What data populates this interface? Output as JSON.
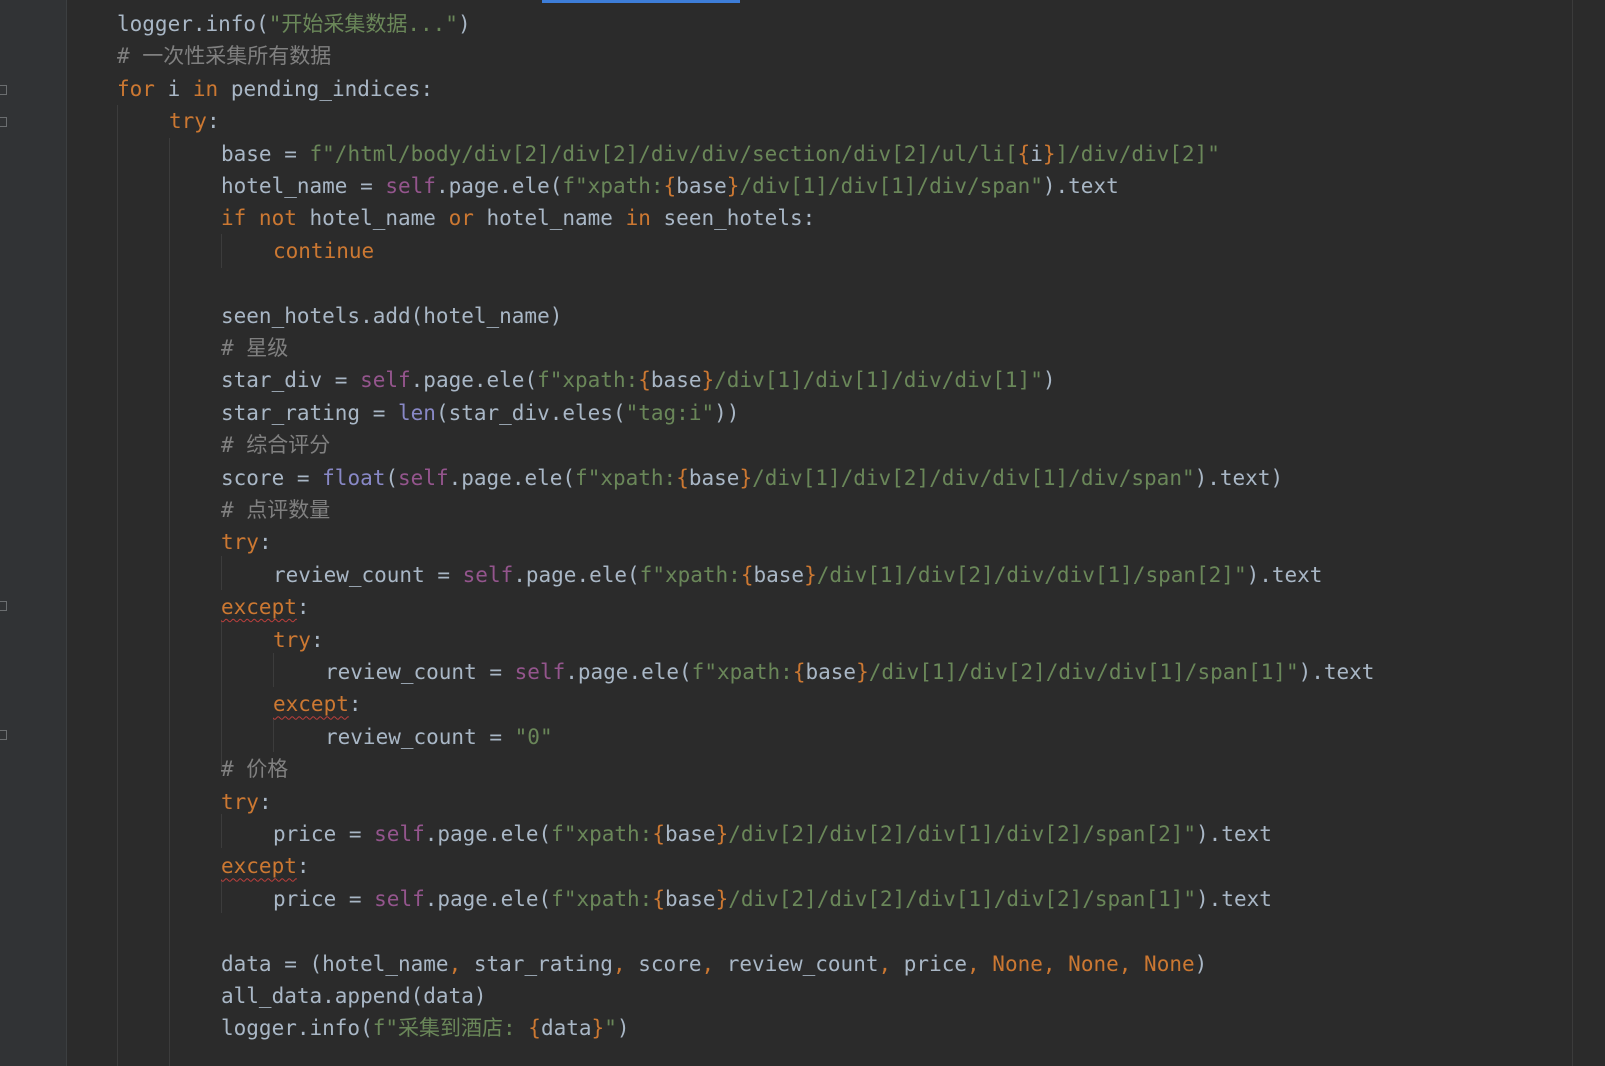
{
  "colors": {
    "background": "#2b2b2b",
    "gutter": "#313335",
    "keyword": "#cc7832",
    "self": "#94558d",
    "string": "#6a8759",
    "comment": "#808080",
    "builtin": "#8888c6",
    "text": "#a9b7c6",
    "scroll_thumb": "#3d7dd8",
    "warning_underline": "#bc3f3c"
  },
  "code_lines": [
    {
      "indent": 1,
      "tokens": [
        {
          "t": "logger.info(",
          "c": "plain"
        },
        {
          "t": "\"开始采集数据...\"",
          "c": "str"
        },
        {
          "t": ")",
          "c": "plain"
        }
      ]
    },
    {
      "indent": 1,
      "tokens": [
        {
          "t": "# 一次性采集所有数据",
          "c": "cmt"
        }
      ]
    },
    {
      "indent": 1,
      "tokens": [
        {
          "t": "for",
          "c": "kw"
        },
        {
          "t": " i ",
          "c": "plain"
        },
        {
          "t": "in",
          "c": "kw"
        },
        {
          "t": " pending_indices:",
          "c": "plain"
        }
      ]
    },
    {
      "indent": 2,
      "tokens": [
        {
          "t": "try",
          "c": "kw"
        },
        {
          "t": ":",
          "c": "plain"
        }
      ]
    },
    {
      "indent": 3,
      "tokens": [
        {
          "t": "base = ",
          "c": "plain"
        },
        {
          "t": "f\"/html/body/div[2]/div[2]/div/div/section/div[2]/ul/li[",
          "c": "str"
        },
        {
          "t": "{",
          "c": "br"
        },
        {
          "t": "i",
          "c": "plain"
        },
        {
          "t": "}",
          "c": "br"
        },
        {
          "t": "]/div/div[2]\"",
          "c": "str"
        }
      ]
    },
    {
      "indent": 3,
      "tokens": [
        {
          "t": "hotel_name = ",
          "c": "plain"
        },
        {
          "t": "self",
          "c": "self"
        },
        {
          "t": ".page.ele(",
          "c": "plain"
        },
        {
          "t": "f\"xpath:",
          "c": "str"
        },
        {
          "t": "{",
          "c": "br"
        },
        {
          "t": "base",
          "c": "plain"
        },
        {
          "t": "}",
          "c": "br"
        },
        {
          "t": "/div[1]/div[1]/div/span\"",
          "c": "str"
        },
        {
          "t": ").text",
          "c": "plain"
        }
      ]
    },
    {
      "indent": 3,
      "tokens": [
        {
          "t": "if not",
          "c": "kw"
        },
        {
          "t": " hotel_name ",
          "c": "plain"
        },
        {
          "t": "or",
          "c": "kw"
        },
        {
          "t": " hotel_name ",
          "c": "plain"
        },
        {
          "t": "in",
          "c": "kw"
        },
        {
          "t": " seen_hotels:",
          "c": "plain"
        }
      ]
    },
    {
      "indent": 4,
      "tokens": [
        {
          "t": "continue",
          "c": "kw"
        }
      ]
    },
    {
      "indent": 0,
      "tokens": []
    },
    {
      "indent": 3,
      "tokens": [
        {
          "t": "seen_hotels.add(hotel_name)",
          "c": "plain"
        }
      ]
    },
    {
      "indent": 3,
      "tokens": [
        {
          "t": "# 星级",
          "c": "cmt"
        }
      ]
    },
    {
      "indent": 3,
      "tokens": [
        {
          "t": "star_div = ",
          "c": "plain"
        },
        {
          "t": "self",
          "c": "self"
        },
        {
          "t": ".page.ele(",
          "c": "plain"
        },
        {
          "t": "f\"xpath:",
          "c": "str"
        },
        {
          "t": "{",
          "c": "br"
        },
        {
          "t": "base",
          "c": "plain"
        },
        {
          "t": "}",
          "c": "br"
        },
        {
          "t": "/div[1]/div[1]/div/div[1]\"",
          "c": "str"
        },
        {
          "t": ")",
          "c": "plain"
        }
      ]
    },
    {
      "indent": 3,
      "tokens": [
        {
          "t": "star_rating = ",
          "c": "plain"
        },
        {
          "t": "len",
          "c": "bi"
        },
        {
          "t": "(star_div.eles(",
          "c": "plain"
        },
        {
          "t": "\"tag:i\"",
          "c": "str"
        },
        {
          "t": "))",
          "c": "plain"
        }
      ]
    },
    {
      "indent": 3,
      "tokens": [
        {
          "t": "# 综合评分",
          "c": "cmt"
        }
      ]
    },
    {
      "indent": 3,
      "tokens": [
        {
          "t": "score = ",
          "c": "plain"
        },
        {
          "t": "float",
          "c": "bi"
        },
        {
          "t": "(",
          "c": "plain"
        },
        {
          "t": "self",
          "c": "self"
        },
        {
          "t": ".page.ele(",
          "c": "plain"
        },
        {
          "t": "f\"xpath:",
          "c": "str"
        },
        {
          "t": "{",
          "c": "br"
        },
        {
          "t": "base",
          "c": "plain"
        },
        {
          "t": "}",
          "c": "br"
        },
        {
          "t": "/div[1]/div[2]/div/div[1]/div/span\"",
          "c": "str"
        },
        {
          "t": ").text)",
          "c": "plain"
        }
      ]
    },
    {
      "indent": 3,
      "tokens": [
        {
          "t": "# 点评数量",
          "c": "cmt"
        }
      ]
    },
    {
      "indent": 3,
      "tokens": [
        {
          "t": "try",
          "c": "kw"
        },
        {
          "t": ":",
          "c": "plain"
        }
      ]
    },
    {
      "indent": 4,
      "tokens": [
        {
          "t": "review_count = ",
          "c": "plain"
        },
        {
          "t": "self",
          "c": "self"
        },
        {
          "t": ".page.ele(",
          "c": "plain"
        },
        {
          "t": "f\"xpath:",
          "c": "str"
        },
        {
          "t": "{",
          "c": "br"
        },
        {
          "t": "base",
          "c": "plain"
        },
        {
          "t": "}",
          "c": "br"
        },
        {
          "t": "/div[1]/div[2]/div/div[1]/span[2]\"",
          "c": "str"
        },
        {
          "t": ").text",
          "c": "plain"
        }
      ]
    },
    {
      "indent": 3,
      "tokens": [
        {
          "t": "except",
          "c": "kw",
          "warn": true
        },
        {
          "t": ":",
          "c": "plain"
        }
      ]
    },
    {
      "indent": 4,
      "tokens": [
        {
          "t": "try",
          "c": "kw"
        },
        {
          "t": ":",
          "c": "plain"
        }
      ]
    },
    {
      "indent": 5,
      "tokens": [
        {
          "t": "review_count = ",
          "c": "plain"
        },
        {
          "t": "self",
          "c": "self"
        },
        {
          "t": ".page.ele(",
          "c": "plain"
        },
        {
          "t": "f\"xpath:",
          "c": "str"
        },
        {
          "t": "{",
          "c": "br"
        },
        {
          "t": "base",
          "c": "plain"
        },
        {
          "t": "}",
          "c": "br"
        },
        {
          "t": "/div[1]/div[2]/div/div[1]/span[1]\"",
          "c": "str"
        },
        {
          "t": ").text",
          "c": "plain"
        }
      ]
    },
    {
      "indent": 4,
      "tokens": [
        {
          "t": "except",
          "c": "kw",
          "warn": true
        },
        {
          "t": ":",
          "c": "plain"
        }
      ]
    },
    {
      "indent": 5,
      "tokens": [
        {
          "t": "review_count = ",
          "c": "plain"
        },
        {
          "t": "\"0\"",
          "c": "str"
        }
      ]
    },
    {
      "indent": 3,
      "tokens": [
        {
          "t": "# 价格",
          "c": "cmt"
        }
      ]
    },
    {
      "indent": 3,
      "tokens": [
        {
          "t": "try",
          "c": "kw"
        },
        {
          "t": ":",
          "c": "plain"
        }
      ]
    },
    {
      "indent": 4,
      "tokens": [
        {
          "t": "price = ",
          "c": "plain"
        },
        {
          "t": "self",
          "c": "self"
        },
        {
          "t": ".page.ele(",
          "c": "plain"
        },
        {
          "t": "f\"xpath:",
          "c": "str"
        },
        {
          "t": "{",
          "c": "br"
        },
        {
          "t": "base",
          "c": "plain"
        },
        {
          "t": "}",
          "c": "br"
        },
        {
          "t": "/div[2]/div[2]/div[1]/div[2]/span[2]\"",
          "c": "str"
        },
        {
          "t": ").text",
          "c": "plain"
        }
      ]
    },
    {
      "indent": 3,
      "tokens": [
        {
          "t": "except",
          "c": "kw",
          "warn": true
        },
        {
          "t": ":",
          "c": "plain"
        }
      ]
    },
    {
      "indent": 4,
      "tokens": [
        {
          "t": "price = ",
          "c": "plain"
        },
        {
          "t": "self",
          "c": "self"
        },
        {
          "t": ".page.ele(",
          "c": "plain"
        },
        {
          "t": "f\"xpath:",
          "c": "str"
        },
        {
          "t": "{",
          "c": "br"
        },
        {
          "t": "base",
          "c": "plain"
        },
        {
          "t": "}",
          "c": "br"
        },
        {
          "t": "/div[2]/div[2]/div[1]/div[2]/span[1]\"",
          "c": "str"
        },
        {
          "t": ").text",
          "c": "plain"
        }
      ]
    },
    {
      "indent": 0,
      "tokens": []
    },
    {
      "indent": 3,
      "tokens": [
        {
          "t": "data = (hotel_name",
          "c": "plain"
        },
        {
          "t": ", ",
          "c": "punc"
        },
        {
          "t": "star_rating",
          "c": "plain"
        },
        {
          "t": ", ",
          "c": "punc"
        },
        {
          "t": "score",
          "c": "plain"
        },
        {
          "t": ", ",
          "c": "punc"
        },
        {
          "t": "review_count",
          "c": "plain"
        },
        {
          "t": ", ",
          "c": "punc"
        },
        {
          "t": "price",
          "c": "plain"
        },
        {
          "t": ", ",
          "c": "punc"
        },
        {
          "t": "None",
          "c": "kw"
        },
        {
          "t": ", ",
          "c": "punc"
        },
        {
          "t": "None",
          "c": "kw"
        },
        {
          "t": ", ",
          "c": "punc"
        },
        {
          "t": "None",
          "c": "kw"
        },
        {
          "t": ")",
          "c": "plain"
        }
      ]
    },
    {
      "indent": 3,
      "tokens": [
        {
          "t": "all_data.append(data)",
          "c": "plain"
        }
      ]
    },
    {
      "indent": 3,
      "tokens": [
        {
          "t": "logger.info(",
          "c": "plain"
        },
        {
          "t": "f\"采集到酒店: ",
          "c": "str"
        },
        {
          "t": "{",
          "c": "br"
        },
        {
          "t": "data",
          "c": "plain"
        },
        {
          "t": "}",
          "c": "br"
        },
        {
          "t": "\"",
          "c": "str"
        },
        {
          "t": ")",
          "c": "plain"
        }
      ]
    }
  ]
}
